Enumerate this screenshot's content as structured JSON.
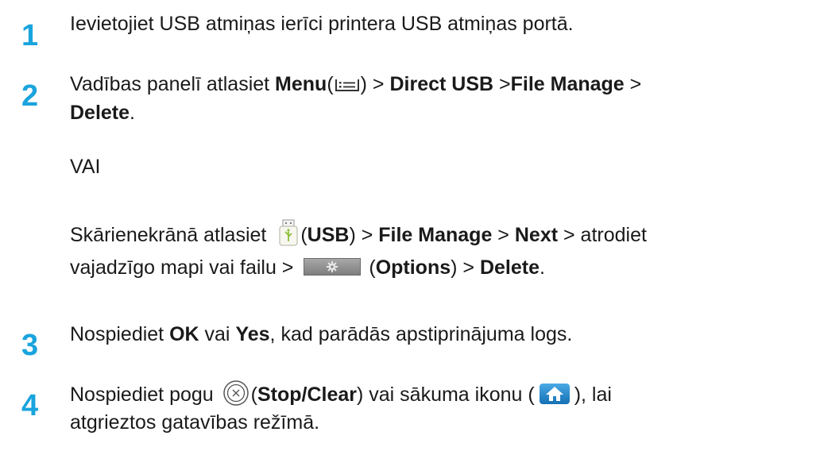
{
  "colors": {
    "step_number": "#1aa4dd",
    "text": "#1a1a1a",
    "home_button": "#1e88cc"
  },
  "steps": [
    {
      "number": "1",
      "line1": "Ievietojiet USB atmiņas ierīci printera USB atmiņas portā."
    },
    {
      "number": "2",
      "t1": "Vadības panelī atlasiet ",
      "menu": "Menu",
      "t2": "(",
      "t3": ") > ",
      "direct_usb": "Direct USB",
      "t4": " >",
      "file_manage": "File Manage",
      "t5": " >",
      "delete": "Delete",
      "t6": ".",
      "or": "VAI",
      "t7": "Skārienekrānā atlasiet ",
      "t8": "(",
      "usb": "USB",
      "t9": ") > ",
      "file_manage2": "File Manage",
      "t10": " > ",
      "next": "Next",
      "t11": " > atrodiet",
      "t12": "vajadzīgo mapi vai failu > ",
      "t13": "(",
      "options": "Options",
      "t14": ") > ",
      "delete2": "Delete",
      "t15": "."
    },
    {
      "number": "3",
      "t1": "Nospiediet ",
      "ok": "OK",
      "t2": " vai ",
      "yes": "Yes",
      "t3": ", kad parādās apstiprinājuma logs."
    },
    {
      "number": "4",
      "t1": "Nospiediet pogu ",
      "t2": "(",
      "stop_clear": "Stop/Clear",
      "t3": ") vai sākuma ikonu (",
      "t4": "), lai",
      "line2": "atgrieztos gatavības režīmā."
    }
  ],
  "icons": {
    "menu": "menu-icon",
    "usb": "usb-drive-icon",
    "options": "gear-icon",
    "stop": "stop-clear-icon",
    "home": "home-icon"
  }
}
